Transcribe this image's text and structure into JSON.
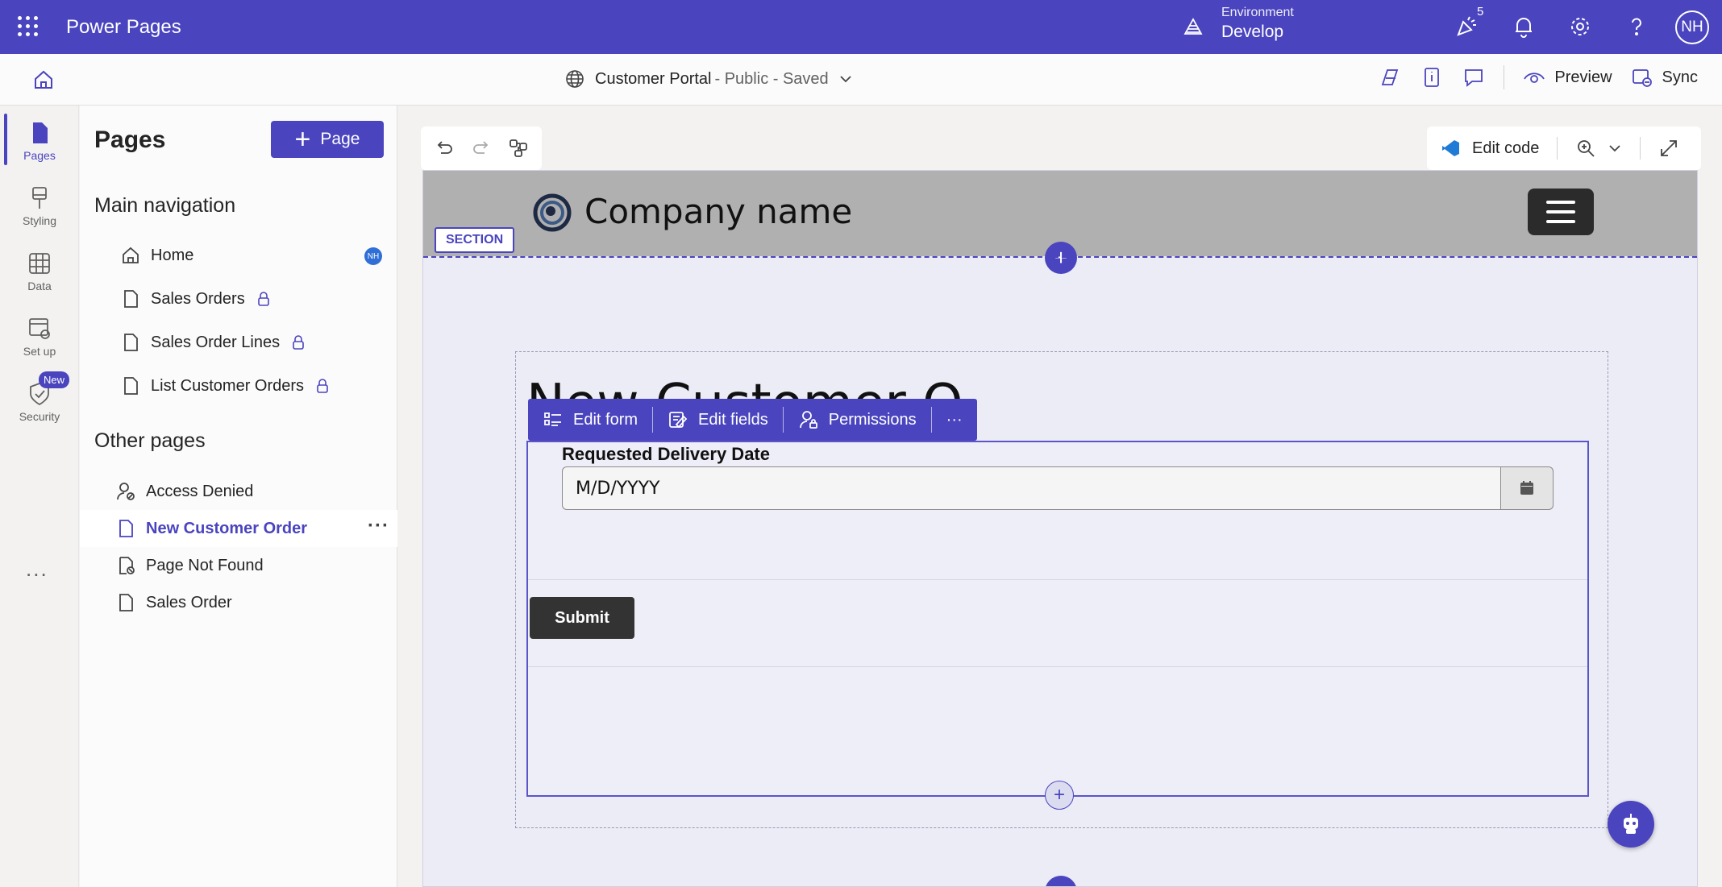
{
  "app": {
    "name": "Power Pages"
  },
  "environment": {
    "label": "Environment",
    "value": "Develop"
  },
  "notifications": {
    "count": "5"
  },
  "user": {
    "initials": "NH"
  },
  "site": {
    "name": "Customer Portal",
    "status": "- Public - Saved"
  },
  "commands": {
    "preview": "Preview",
    "sync": "Sync"
  },
  "rail": {
    "items": [
      {
        "label": "Pages"
      },
      {
        "label": "Styling"
      },
      {
        "label": "Data"
      },
      {
        "label": "Set up"
      },
      {
        "label": "Security"
      }
    ],
    "new_badge": "New",
    "more": "..."
  },
  "pages_panel": {
    "title": "Pages",
    "add_label": "Page",
    "main_nav_title": "Main navigation",
    "main_nav": [
      {
        "label": "Home",
        "badge": "NH"
      },
      {
        "label": "Sales Orders"
      },
      {
        "label": "Sales Order Lines"
      },
      {
        "label": "List Customer Orders"
      }
    ],
    "other_title": "Other pages",
    "other": [
      {
        "label": "Access Denied"
      },
      {
        "label": "New Customer Order"
      },
      {
        "label": "Page Not Found"
      },
      {
        "label": "Sales Order"
      }
    ],
    "more": "···"
  },
  "canvas": {
    "edit_code": "Edit code",
    "section_tag": "SECTION",
    "company_name": "Company name",
    "page_heading": "New Customer Order",
    "form_toolbar": {
      "edit_form": "Edit form",
      "edit_fields": "Edit fields",
      "permissions": "Permissions",
      "more": "···"
    },
    "form": {
      "field_label": "Requested Delivery Date",
      "placeholder": "M/D/YYYY",
      "submit": "Submit"
    }
  },
  "colors": {
    "brand": "#4a44bf",
    "header_bg": "#b0b0b0",
    "submit_bg": "#333333"
  }
}
